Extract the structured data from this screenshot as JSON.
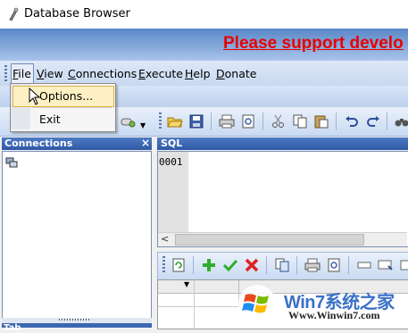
{
  "window": {
    "title": "Database Browser"
  },
  "banner": {
    "text": "Please support develo"
  },
  "menu": {
    "items": [
      {
        "id": "file",
        "label": "File",
        "mnemonic_index": 0
      },
      {
        "id": "view",
        "label": "View",
        "mnemonic_index": 0
      },
      {
        "id": "connections",
        "label": "Connections",
        "mnemonic_index": 0
      },
      {
        "id": "execute",
        "label": "Execute",
        "mnemonic_index": 0
      },
      {
        "id": "help",
        "label": "Help",
        "mnemonic_index": 0
      },
      {
        "id": "donate",
        "label": "Donate",
        "mnemonic_index": 0
      }
    ],
    "file_dropdown": {
      "options_label": "Options...",
      "exit_label": "Exit"
    }
  },
  "connections_panel": {
    "title": "Connections",
    "close_glyph": "×"
  },
  "sql_panel": {
    "title": "SQL",
    "line_number": "0001",
    "scroll_left_glyph": "<"
  },
  "bottom_panel": {
    "title": "Tab"
  },
  "watermark": {
    "brand": "Win7系统之家",
    "url": "Www.Winwin7.com"
  },
  "colors": {
    "banner_text": "#e80000",
    "panel_header": "#3d66b0",
    "menu_highlight": "#fdf1c3"
  },
  "icons": {
    "main_toolbar": [
      "open-folder-icon",
      "save-icon",
      "print-icon",
      "print-preview-icon",
      "cut-icon",
      "copy-icon",
      "paste-icon",
      "undo-icon",
      "redo-icon",
      "binoculars-icon"
    ],
    "results_toolbar": [
      "refresh-icon",
      "add-icon",
      "commit-check-icon",
      "delete-icon",
      "export-icon",
      "print-icon",
      "print-preview-icon",
      "field-icon",
      "insert-icon"
    ]
  }
}
